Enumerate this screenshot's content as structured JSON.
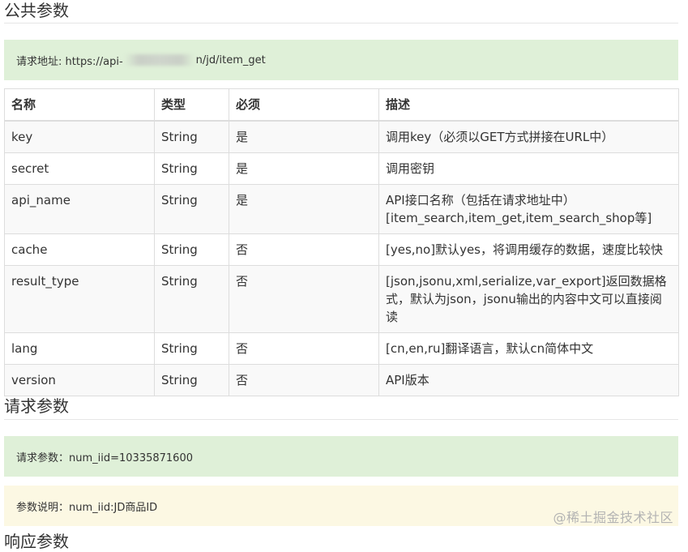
{
  "public_params": {
    "heading": "公共参数",
    "request_url_prefix": "请求地址: https://api-",
    "request_url_suffix": "n/jd/item_get"
  },
  "table": {
    "headers": [
      "名称",
      "类型",
      "必须",
      "描述"
    ],
    "rows": [
      {
        "name": "key",
        "type": "String",
        "required": "是",
        "desc": "调用key（必须以GET方式拼接在URL中）"
      },
      {
        "name": "secret",
        "type": "String",
        "required": "是",
        "desc": "调用密钥"
      },
      {
        "name": "api_name",
        "type": "String",
        "required": "是",
        "desc": "API接口名称（包括在请求地址中）[item_search,item_get,item_search_shop等]"
      },
      {
        "name": "cache",
        "type": "String",
        "required": "否",
        "desc": "[yes,no]默认yes，将调用缓存的数据，速度比较快"
      },
      {
        "name": "result_type",
        "type": "String",
        "required": "否",
        "desc": "[json,jsonu,xml,serialize,var_export]返回数据格式，默认为json，jsonu输出的内容中文可以直接阅读"
      },
      {
        "name": "lang",
        "type": "String",
        "required": "否",
        "desc": "[cn,en,ru]翻译语言，默认cn简体中文"
      },
      {
        "name": "version",
        "type": "String",
        "required": "否",
        "desc": "API版本"
      }
    ]
  },
  "request_params": {
    "heading": "请求参数",
    "params_line": "请求参数：num_iid=10335871600",
    "explain_line": "参数说明：num_iid:JD商品ID"
  },
  "next_heading": "响应参数",
  "watermark": "@稀土掘金技术社区",
  "colors": {
    "success_bg": "#dff0d8",
    "warning_bg": "#fcf8e3",
    "border": "#dddddd",
    "stripe": "#f9f9f9"
  }
}
